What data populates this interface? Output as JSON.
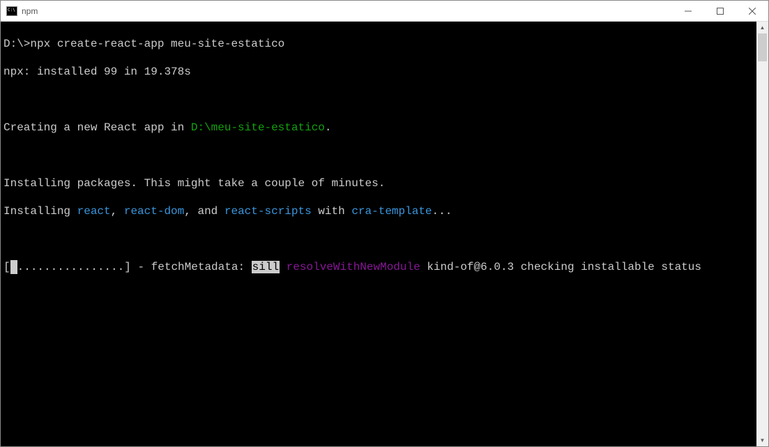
{
  "window": {
    "title": "npm"
  },
  "terminal": {
    "prompt": "D:\\>",
    "command": "npx create-react-app meu-site-estatico",
    "line2": "npx: installed 99 in 19.378s",
    "line3_pre": "Creating a new React app in ",
    "line3_path": "D:\\meu-site-estatico",
    "line3_post": ".",
    "line4": "Installing packages. This might take a couple of minutes.",
    "line5_pre": "Installing ",
    "pkg1": "react",
    "sep1": ", ",
    "pkg2": "react-dom",
    "sep2": ", and ",
    "pkg3": "react-scripts",
    "sep3": " with ",
    "template": "cra-template",
    "line5_post": "...",
    "progress_open": "[",
    "progress_dots": "................",
    "progress_close": "] - fetchMetadata: ",
    "sill": "sill",
    "resolve": " resolveWithNewModule",
    "status_rest": " kind-of@6.0.3 checking installable status"
  }
}
